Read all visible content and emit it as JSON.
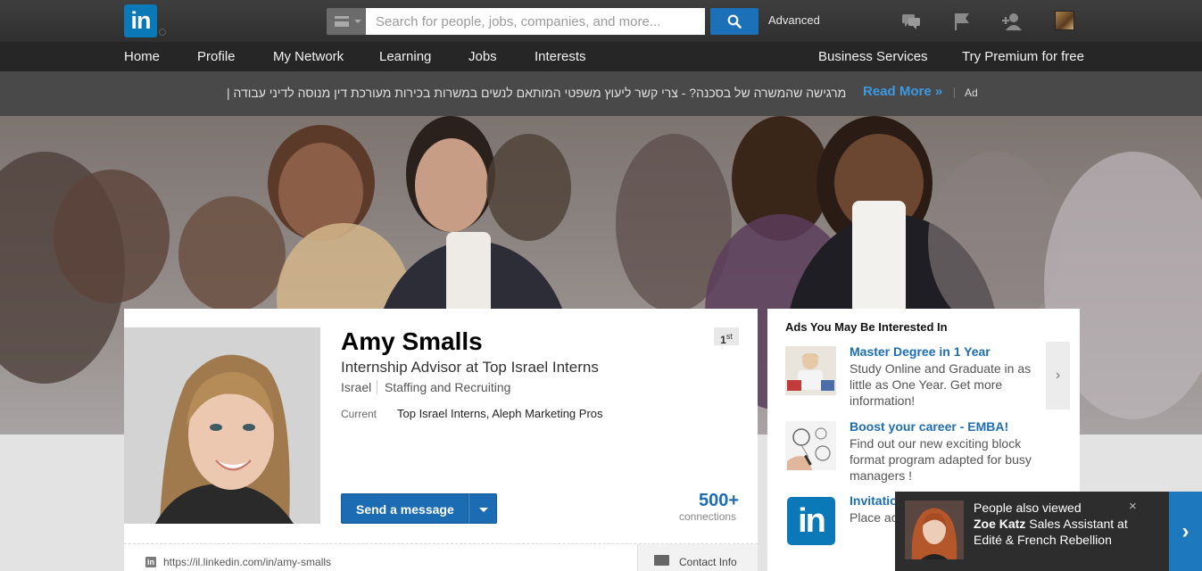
{
  "topbar": {
    "logo": "in",
    "search_placeholder": "Search for people, jobs, companies, and more...",
    "advanced": "Advanced",
    "icons": [
      "menu-icon",
      "search-icon",
      "messages-icon",
      "flag-icon",
      "add-connection-icon",
      "account-avatar"
    ]
  },
  "nav": {
    "items": [
      "Home",
      "Profile",
      "My Network",
      "Learning",
      "Jobs",
      "Interests"
    ],
    "right": [
      "Business Services",
      "Try Premium for free"
    ]
  },
  "ad_strip": {
    "text": "מרגישה שהמשרה של בסכנה? - צרי קשר ליעוץ משפטי המותאם לנשים במשרות בכירות מעורכת דין מנוסה לדיני עבודה |",
    "read_more": "Read More »",
    "ad_label": "Ad"
  },
  "profile": {
    "name": "Amy Smalls",
    "headline": "Internship Advisor at Top Israel Interns",
    "location": "Israel",
    "industry": "Staffing and Recruiting",
    "current_label": "Current",
    "current_value": "Top Israel Interns, Aleph Marketing Pros",
    "degree": "1",
    "degree_suffix": "st",
    "message_button": "Send a message",
    "connections": "500+",
    "connections_label": "connections",
    "url": "https://il.linkedin.com/in/amy-smalls",
    "contact_info": "Contact Info"
  },
  "ads_panel": {
    "title": "Ads You May Be Interested In",
    "items": [
      {
        "title": "Master Degree in 1 Year",
        "body": "Study Online and Graduate in as little as One Year. Get more information!"
      },
      {
        "title": "Boost your career - EMBA!",
        "body": "Find out our new exciting block format program adapted for busy managers !"
      },
      {
        "title": "Invitatio",
        "body": "Place ac new cus busines"
      }
    ],
    "next": "›"
  },
  "people_also_viewed": {
    "title": "People also viewed",
    "person_name": "Zoe Katz",
    "person_detail": "Sales Assistant at Edité & French Rebellion",
    "close": "×",
    "next": "›"
  },
  "colors": {
    "linkedin_blue": "#0b78b7",
    "link_blue": "#1d6db3",
    "topbar": "#333333"
  }
}
